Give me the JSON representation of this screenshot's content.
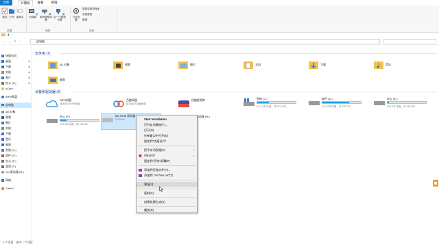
{
  "tabs": [
    {
      "label": "文件"
    },
    {
      "label": "计算机"
    },
    {
      "label": "查看"
    },
    {
      "label": "管理"
    }
  ],
  "ribbon": {
    "buttons": [
      {
        "label": "属性"
      },
      {
        "label": "打开"
      },
      {
        "label": "重命名"
      },
      {
        "label": "访问媒体"
      },
      {
        "label": "映射网络驱动器"
      },
      {
        "label": "添加一个网络位置"
      },
      {
        "label": "打开设置"
      },
      {
        "label": "卸载或更改程序"
      },
      {
        "label": "系统属性"
      },
      {
        "label": "管理"
      }
    ],
    "groups": [
      "位置",
      "网络",
      "系统"
    ]
  },
  "address": {
    "path": "此电脑"
  },
  "sidebar": {
    "items": [
      {
        "label": "快速访问"
      },
      {
        "label": "桌面"
      },
      {
        "label": "下载"
      },
      {
        "label": "文档"
      },
      {
        "label": "图片"
      },
      {
        "label": "办公 (E:)"
      },
      {
        "label": "oCam"
      },
      {
        "label": "WPS网盘"
      },
      {
        "label": "此电脑"
      },
      {
        "label": "3D 对象"
      },
      {
        "label": "视频"
      },
      {
        "label": "图片"
      },
      {
        "label": "文档"
      },
      {
        "label": "下载"
      },
      {
        "label": "音乐"
      },
      {
        "label": "桌面"
      },
      {
        "label": "系统 (C:)"
      },
      {
        "label": "软件 (D:)"
      },
      {
        "label": "办公 (E:)"
      },
      {
        "label": "游戏 (F:)"
      },
      {
        "label": "CD 驱动器 (H:)"
      },
      {
        "label": "网络"
      },
      {
        "label": "Catch!"
      }
    ]
  },
  "folders_section": {
    "title": "文件夹 (7)"
  },
  "folders": [
    {
      "label": "3D 对象"
    },
    {
      "label": "视频"
    },
    {
      "label": "图片"
    },
    {
      "label": "文档"
    },
    {
      "label": "下载"
    },
    {
      "label": "音乐"
    },
    {
      "label": "桌面"
    }
  ],
  "drives_section": {
    "title": "设备和驱动器 (9)"
  },
  "drives": [
    {
      "name": "WPS网盘",
      "sub": "双击进入WPS网盘",
      "usage": null,
      "color": "#26a0da"
    },
    {
      "name": "百度网盘",
      "sub": "双击运行百度网盘",
      "usage": null,
      "color": "#26a0da"
    },
    {
      "name": "优酷影视库",
      "sub": "",
      "usage": null,
      "color": "#26a0da"
    },
    {
      "name": "系统 (C:)",
      "sub": "41.4 GB 可用，共 59.9 GB",
      "usage": 0.31,
      "color": "#26a0da"
    },
    {
      "name": "软件 (D:)",
      "sub": "29.9 GB 可用，共 100 GB",
      "usage": 0.7,
      "color": "#26a0da"
    },
    {
      "name": "办公 (E:)",
      "sub": "153 GB 可用，共 160 GB",
      "usage": 0.04,
      "color": "#26a0da"
    },
    {
      "name": "办公 (F:)",
      "sub": "134 GB 可用，共 160 GB",
      "usage": 0.16,
      "color": "#26a0da"
    },
    {
      "name": "BD-ROM 驱动器 (G:)",
      "sub": "DVDFab",
      "usage": null,
      "color": "#26a0da"
    },
    {
      "name": "CD 驱动器 (H:)",
      "sub": "",
      "usage": null,
      "color": "#26a0da"
    }
  ],
  "context_menu": {
    "items": [
      {
        "label": "Start Installation",
        "bold": true
      },
      {
        "label": "打开自动播放(Y)..."
      },
      {
        "label": "打开(O)"
      },
      {
        "label": "在新窗口中打开(E)"
      },
      {
        "label": "固定到\"快速访问\""
      },
      {
        "label": "授予访问权限(G)",
        "submenu": true
      },
      {
        "label": "UltraISO",
        "submenu": true
      },
      {
        "label": "固定到\"开始\"屏幕(P)"
      },
      {
        "label": "添加到压缩文件(A)..."
      },
      {
        "label": "添加到 \"Archive.rar\"(T)"
      },
      {
        "label": "弹出(J)"
      },
      {
        "label": "复制(C)"
      },
      {
        "label": "创建快捷方式(S)"
      },
      {
        "label": "属性(R)"
      }
    ]
  },
  "status": {
    "text": "9 个项目　选中 1 个项目"
  },
  "colors": {
    "accent": "#1979ca",
    "selection": "#cce8ff",
    "folder": "#f4c14f"
  }
}
